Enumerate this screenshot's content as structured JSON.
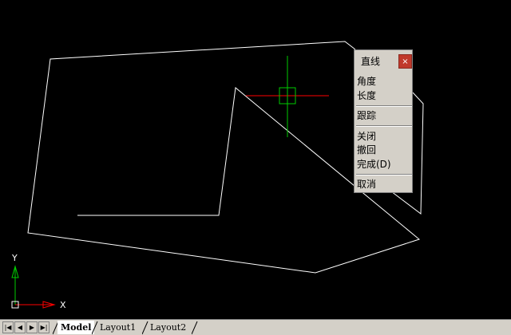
{
  "context_menu": {
    "title": "直线",
    "close_label": "×",
    "items": [
      "角度",
      "长度",
      "跟踪",
      "关闭",
      "撤回",
      "完成(D)",
      "取消"
    ]
  },
  "ucs": {
    "x_label": "X",
    "y_label": "Y"
  },
  "tabs": {
    "model": "Model",
    "layout1": "Layout1",
    "layout2": "Layout2"
  },
  "nav": [
    "|◀",
    "◀",
    "▶",
    "▶|"
  ],
  "colors": {
    "canvas": "#000000",
    "geometry": "#ffffff",
    "crosshair_x": "#ff0000",
    "crosshair_y": "#00ff00",
    "ucs_x": "#ff0000",
    "ucs_y": "#00ff00"
  }
}
